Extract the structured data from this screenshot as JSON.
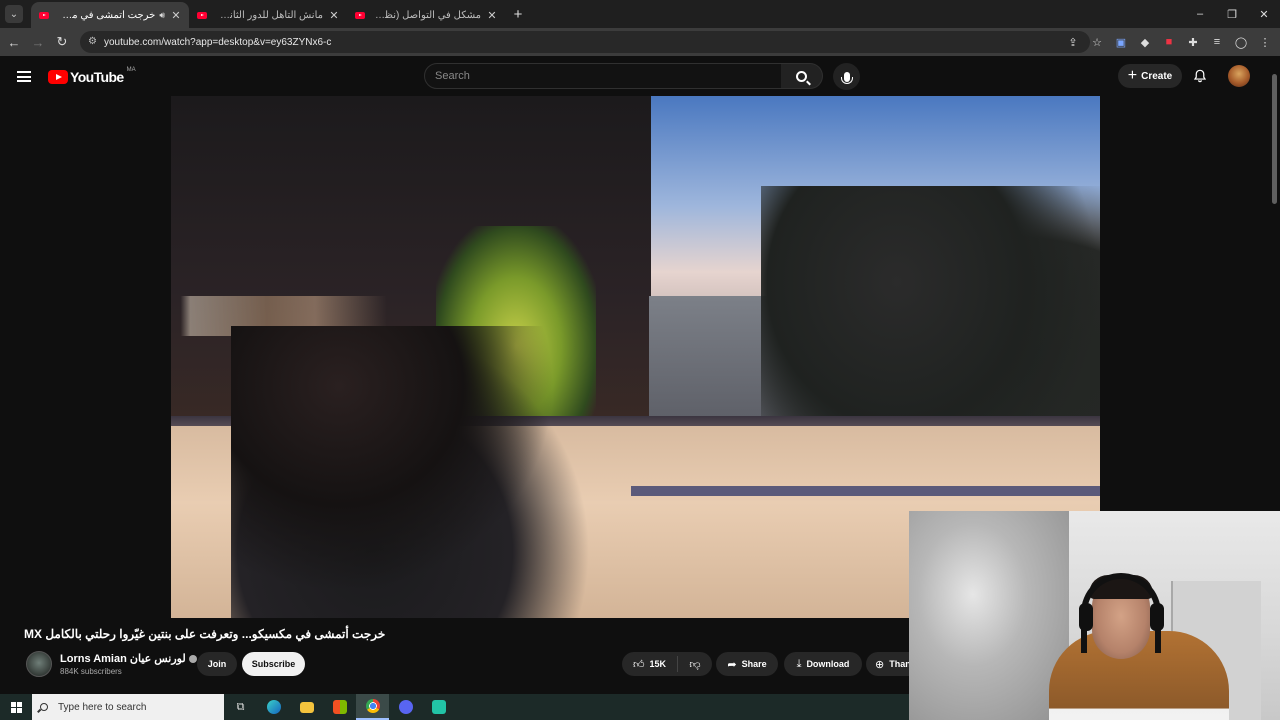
{
  "browser": {
    "tabs": [
      {
        "title": "خرجت أتمشى في مكسيكو... وتعرفت على بنتين غيّروا رحلتي بالكامل",
        "active": true,
        "audio": true
      },
      {
        "title": "مانش التأهل للدور الثاني؟ التشكيلة",
        "active": false,
        "audio": false
      },
      {
        "title": "مشكل في التواصل (نظرية البراكين)",
        "active": false,
        "audio": false
      }
    ],
    "url": "youtube.com/watch?app=desktop&v=ey63ZYNx6-c",
    "window_controls": [
      "–",
      "❐",
      "✕"
    ]
  },
  "youtube": {
    "logo_text": "YouTube",
    "country_code": "MA",
    "search_placeholder": "Search",
    "create_label": "Create"
  },
  "video": {
    "title": "خرجت أتمشى في مكسيكو... وتعرفت على بنتين غيّروا رحلتي بالكامل MX",
    "channel_name": "Lorns Amian لورنس عيان",
    "subscribers": "884K subscribers",
    "join_label": "Join",
    "subscribe_label": "Subscribe",
    "likes": "15K",
    "share_label": "Share",
    "download_label": "Download",
    "thanks_label": "Thanks"
  },
  "taskbar": {
    "search_placeholder": "Type here to search",
    "apps": [
      "task-view",
      "edge",
      "file-explorer",
      "store",
      "chrome",
      "discord",
      "other-app"
    ]
  },
  "colors": {
    "youtube_red": "#ff0000",
    "subscribe_bg": "#f1f1f1",
    "page_bg": "#0f0f0f",
    "pill_bg": "#272727"
  }
}
